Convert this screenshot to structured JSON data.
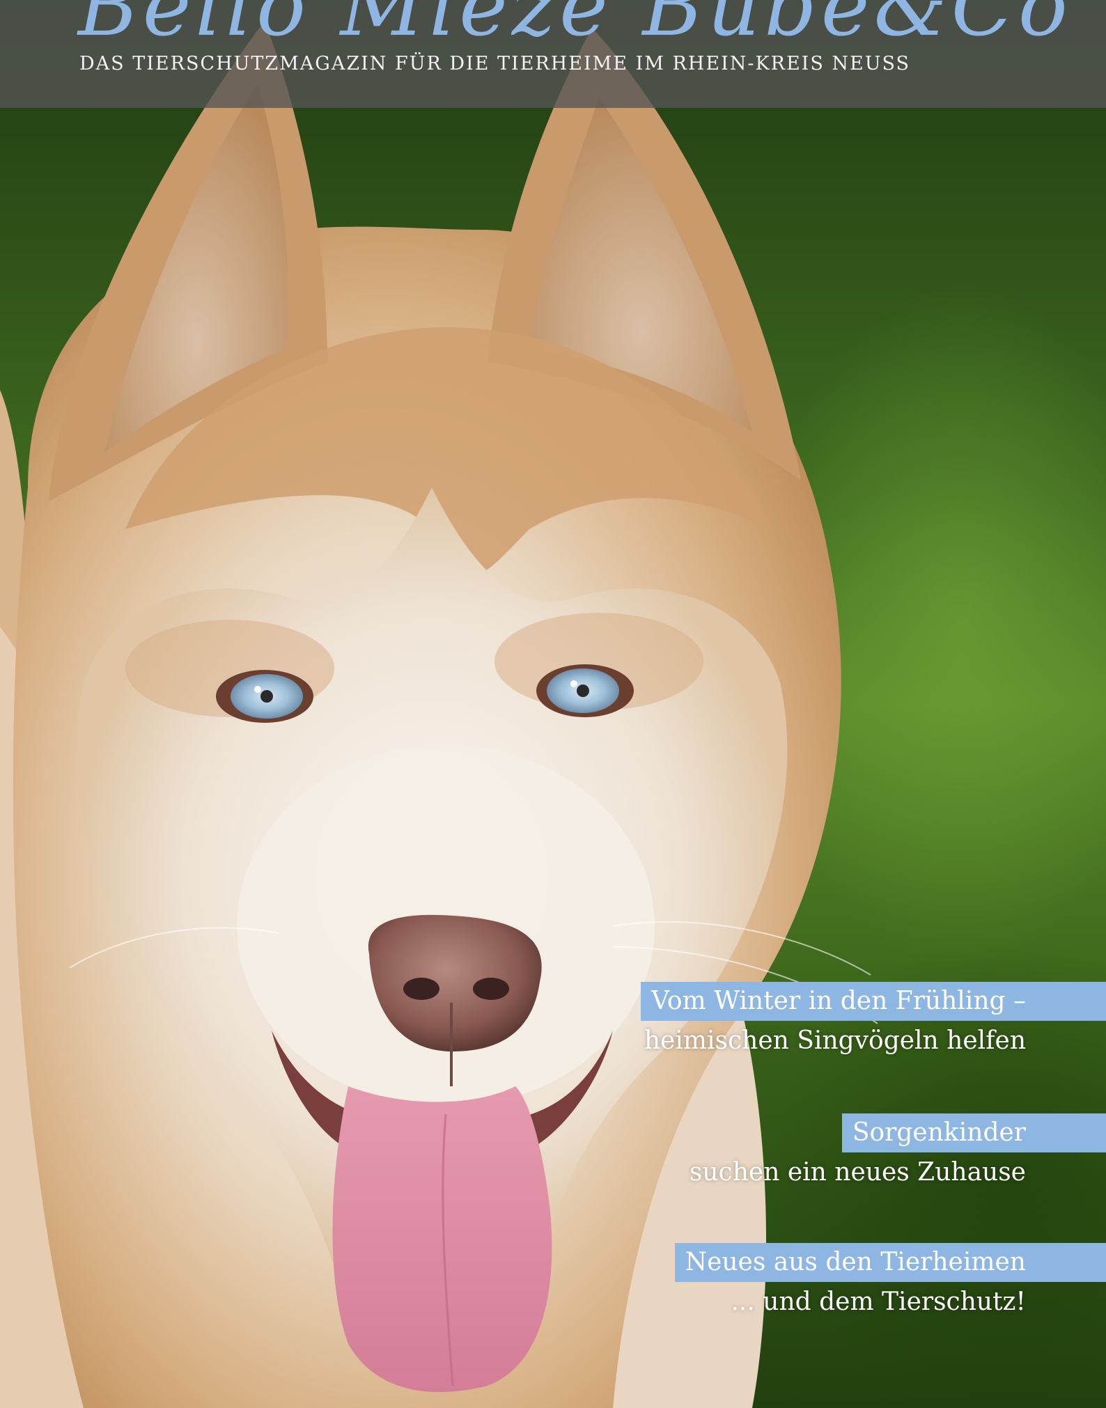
{
  "cover": {
    "masthead": "Bello Mieze Bube&Co",
    "tagline": "DAS TIERSCHUTZMAGAZIN FÜR DIE TIERHEIME IM RHEIN-KREIS NEUSS",
    "photo": "husky-portrait"
  },
  "teasers": [
    {
      "headline": "Vom Winter in den Frühling –",
      "subline": "heimischen Singvögeln helfen"
    },
    {
      "headline": "Sorgenkinder",
      "subline": "suchen ein neues Zuhause"
    },
    {
      "headline": "Neues aus den Tierheimen",
      "subline": "... und dem Tierschutz!"
    }
  ],
  "colors": {
    "accent_blue": "#8eb6e3",
    "header_band": "#555555",
    "background_green": "#3f6a1f"
  }
}
